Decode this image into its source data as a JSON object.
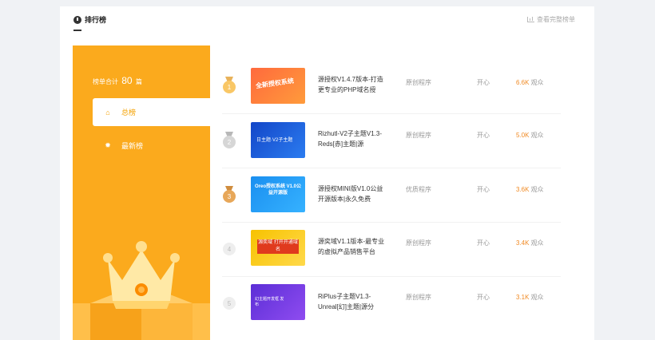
{
  "header": {
    "title": "排行榜",
    "view_all": "查看完整榜单",
    "clock_icon": "clock-icon",
    "chart_icon": "bar-chart-icon"
  },
  "sidebar": {
    "total_prefix": "榜单合计",
    "total_count": "80",
    "total_suffix": "篇",
    "nav": [
      {
        "label": "总榜",
        "icon": "home-icon",
        "active": true
      },
      {
        "label": "最新榜",
        "icon": "gear-icon",
        "active": false
      }
    ],
    "accent": "#fbaa1d"
  },
  "rankings": [
    {
      "rank": "1",
      "title": "源授权V1.4.7版本-打造更专业的PHP域名授",
      "type": "原创程序",
      "author": "开心",
      "views": "6.6K",
      "views_unit": "观众",
      "thumb_text": "全新授权系统"
    },
    {
      "rank": "2",
      "title": "Rizhutl-V2子主题V1.3-Reds[赤]主题|源",
      "type": "原创程序",
      "author": "开心",
      "views": "5.0K",
      "views_unit": "观众",
      "thumb_text": "日主题·V2子主题"
    },
    {
      "rank": "3",
      "title": "源授权MINI版V1.0公益开源版本|永久免费",
      "type": "优质程序",
      "author": "开心",
      "views": "3.6K",
      "views_unit": "观众",
      "thumb_text": "Oreo授权系统 V1.0公益开源版"
    },
    {
      "rank": "4",
      "title": "源奕域V1.1版本-最专业的虚拟产品销售平台",
      "type": "原创程序",
      "author": "开心",
      "views": "3.4K",
      "views_unit": "观众",
      "thumb_text": "源奕域 打开开通域名"
    },
    {
      "rank": "5",
      "title": "RiPlus子主题V1.3-Unreal[幻]主题|源分",
      "type": "原创程序",
      "author": "开心",
      "views": "3.1K",
      "views_unit": "观众",
      "thumb_text": "幻主题开发框 发布"
    }
  ]
}
